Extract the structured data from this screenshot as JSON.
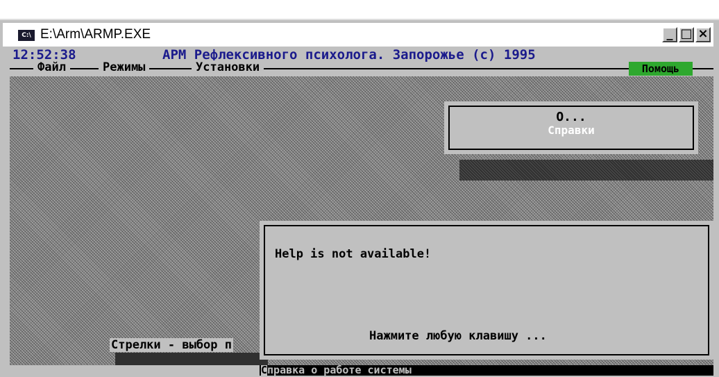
{
  "window": {
    "icon_text": "C:\\",
    "title": "E:\\Arm\\ARMP.EXE",
    "minimize": "_",
    "maximize": "□",
    "close": "×"
  },
  "header": {
    "clock": "12:52:38",
    "app_title": "АРМ Рефлексивного психолога. Запорожье (c) 1995"
  },
  "menu": {
    "items": [
      "Файл",
      "Режимы",
      "Установки"
    ],
    "help": "Помощь"
  },
  "about_menu": {
    "item1": "О...",
    "item2": "Справки"
  },
  "status": {
    "hint": "Стрелки - выбор п"
  },
  "help_dialog": {
    "message": "Help is not available!",
    "press_key": "Нажмите любую клавишу ..."
  },
  "bottom_bar": {
    "first_char": "С",
    "rest": "правка о работе системы"
  }
}
